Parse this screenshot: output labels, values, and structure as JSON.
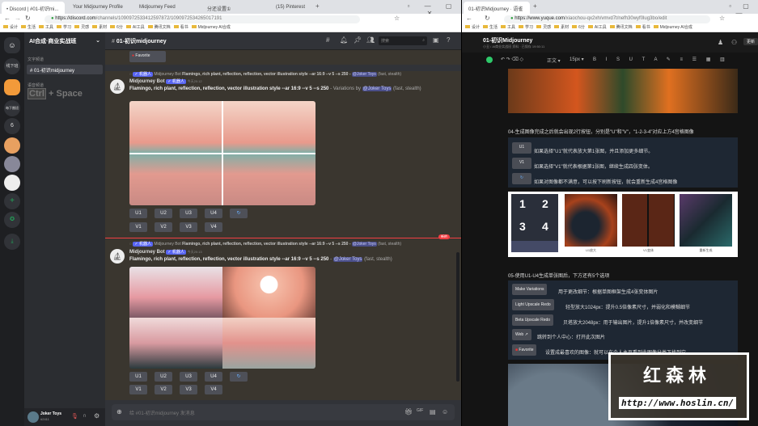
{
  "left_browser": {
    "tabs": [
      "• Discord | #01-初识mi...",
      "Your Midjourney Profile",
      "Midjourney Feed",
      "分还设置①",
      "(15) Pinterest"
    ],
    "url_host": "https://discord.com",
    "url_path": "/channels/1090972533412597872/1090972534265017191",
    "bookmarks": [
      "设计",
      "生活",
      "工具",
      "学习",
      "灵感",
      "素材",
      "6分",
      "AI工具",
      "腾讯文档",
      "看书",
      "Midjourney AI合成"
    ]
  },
  "discord": {
    "server_name": "AI合成·商业实战班",
    "rail": [
      "线下班",
      "每下圈班",
      "6"
    ],
    "categories": [
      "文字频道",
      "语音频道"
    ],
    "channel": "01-初识midjourney",
    "header_channel": "01-初识midjourney",
    "search_placeholder": "搜索",
    "shortcut_hint": [
      "Ctrl",
      "+ Space"
    ],
    "favorite_label": "Favorite",
    "messages": [
      {
        "reply_author": "Midjourney Bot",
        "reply_text": "Flamingo, rich plant, reflection, reflection, vector illustration style --ar 16:9 --v 5 --s 250 -",
        "reply_mention": "@Joker Toys",
        "reply_suffix": "(fast, stealth)",
        "author": "Midjourney Bot",
        "bot_tag": "✓ 机器人",
        "time": "今天20:12",
        "prompt": "Flamingo, rich plant, reflection, reflection, vector illustration style --ar 16:9 --v 5 --s 250",
        "suffix": " - Variations by ",
        "mention": "@Joker Toys",
        "tail": " (fast, stealth)"
      },
      {
        "reply_author": "Midjourney Bot",
        "reply_text": "Flamingo, rich plant, reflection, reflection, vector illustration style --ar 16:9 --v 5 --s 250 -",
        "reply_mention": "@Joker Toys",
        "reply_suffix": "(fast, stealth)",
        "author": "Midjourney Bot",
        "bot_tag": "✓ 机器人",
        "time": "今天20:13",
        "prompt": "Flamingo, rich plant, reflection, reflection, vector illustration style --ar 16:9 --v 5 --s 250",
        "suffix": " - ",
        "mention": "@Joker Toys",
        "tail": " (fast, stealth)"
      }
    ],
    "new_badge": "新的",
    "u_buttons": [
      "U1",
      "U2",
      "U3",
      "U4"
    ],
    "v_buttons": [
      "V1",
      "V2",
      "V3",
      "V4"
    ],
    "refresh_icon": "↻",
    "input_placeholder": "给 #01-初识midjourney 发消息",
    "user": {
      "name": "Joker Toys",
      "tag": "#2411"
    }
  },
  "right_browser": {
    "tab": "01-初识Midjourney · 语雀",
    "url_host": "https://www.yuque.com",
    "url_path": "/xiaochou-qx2xh/vmvd7t/nefh30wyf0lug3bo/edit",
    "bookmarks": [
      "设计",
      "生活",
      "工具",
      "学习",
      "灵感",
      "素材",
      "6分",
      "AI工具",
      "腾讯文档",
      "看书",
      "Midjourney AI合成"
    ],
    "doc_title": "01-初识Midjourney",
    "doc_meta": "小丑 / AI商业实战班 资料 · 已保存 19:50:11",
    "update_button": "更新",
    "toolbar": {
      "style": "正文",
      "size": "15px"
    },
    "section4_title": "04-生成图像完成之后就会出现2行按钮，分别是\"U\"和\"V\"，\"1-2-3-4\"对应上方4宫格图像",
    "section4_items": [
      {
        "btn": "U1",
        "text": "如果选择\"U1\"就代表放大第1张图，并且添加更多细节。"
      },
      {
        "btn": "V1",
        "text": "如果选择\"V1\"就代表根据第1张图，继续生成四张变体。"
      },
      {
        "btn": "↻",
        "text": "如果对图像都不满意，可以按下刷新按钮，就会重新生成4宫格图像"
      }
    ],
    "strip_numbers": [
      "1",
      "2",
      "3",
      "4"
    ],
    "strip_captions": [
      "U1放大",
      "V1变体",
      "重新生成"
    ],
    "section5_title": "05-使用U1-U4生成单张图后，下方还有5个选项",
    "section5_items": [
      {
        "btn": "Make Variations",
        "text": "用于更改细节：根据单图框架生成4张变体图片"
      },
      {
        "btn": "Light Upscale Redo",
        "text": "轻型放大1024px：提升0.5倍像素尺寸，并弱化和模糊细节"
      },
      {
        "btn": "Beta Upscale Redo",
        "text": "贝塔放大2048px：用于输出图片，提升1倍像素尺寸，并改变细节"
      },
      {
        "btn": "Web ↗",
        "text": "跳转到个人中心：打开此次图片"
      },
      {
        "btn": "Favorite",
        "text": "设置成最喜欢的图像：就可以在个人主页看到此图像分类下找到它"
      }
    ]
  },
  "watermark": {
    "name": "红森林",
    "url": "http://www.hoslin.cn/"
  }
}
